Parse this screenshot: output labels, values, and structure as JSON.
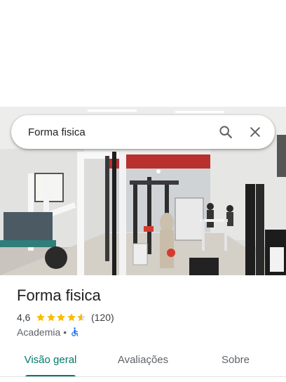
{
  "search": {
    "query": "Forma fisica"
  },
  "icons": {
    "search": "search-icon",
    "close": "close-icon",
    "accessibility": "wheelchair-icon"
  },
  "place": {
    "name": "Forma fisica",
    "rating": "4,6",
    "rating_value": 4.6,
    "review_count": "(120)",
    "category": "Academia",
    "separator": "•"
  },
  "tabs": [
    {
      "label": "Visão geral",
      "active": true
    },
    {
      "label": "Avaliações",
      "active": false
    },
    {
      "label": "Sobre",
      "active": false
    }
  ],
  "colors": {
    "accent": "#00796b",
    "star": "#fbbc04",
    "accessible_icon": "#1a73e8"
  }
}
